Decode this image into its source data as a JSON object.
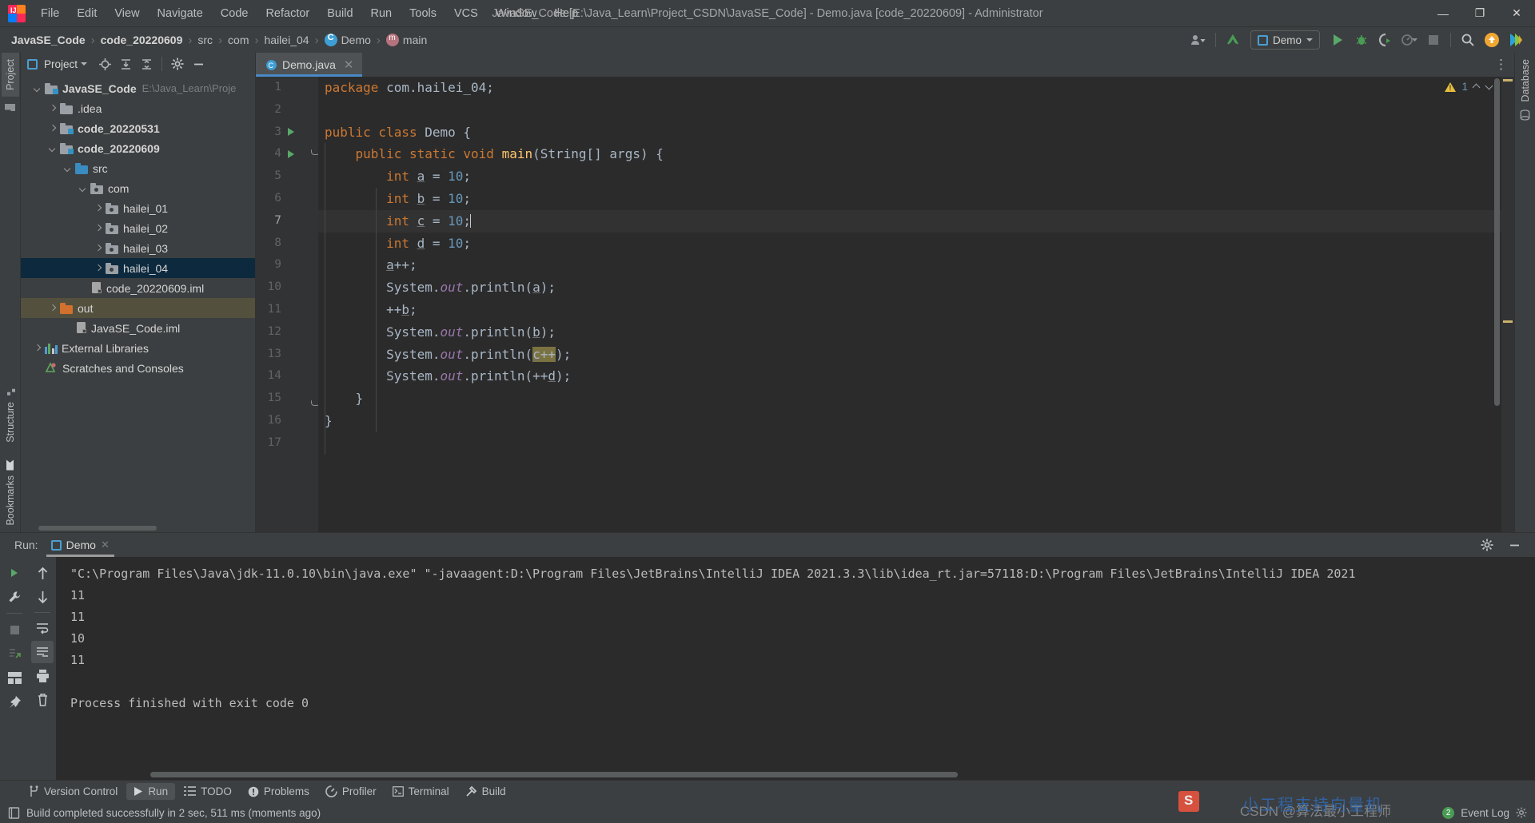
{
  "window": {
    "title": "JavaSE_Code [E:\\Java_Learn\\Project_CSDN\\JavaSE_Code] - Demo.java [code_20220609] - Administrator",
    "minimize": "—",
    "maximize": "❐",
    "close": "✕"
  },
  "menubar": {
    "items": [
      {
        "label": "File"
      },
      {
        "label": "Edit"
      },
      {
        "label": "View"
      },
      {
        "label": "Navigate"
      },
      {
        "label": "Code"
      },
      {
        "label": "Refactor"
      },
      {
        "label": "Build"
      },
      {
        "label": "Run"
      },
      {
        "label": "Tools"
      },
      {
        "label": "VCS"
      },
      {
        "label": "Window"
      },
      {
        "label": "Help"
      }
    ]
  },
  "breadcrumb": {
    "separator": "›",
    "items": [
      {
        "label": "JavaSE_Code",
        "bold": true
      },
      {
        "label": "code_20220609",
        "bold": true
      },
      {
        "label": "src",
        "bold": false
      },
      {
        "label": "com",
        "bold": false
      },
      {
        "label": "hailei_04",
        "bold": false
      },
      {
        "label": "Demo",
        "bold": false,
        "icon": "class-icon"
      },
      {
        "label": "main",
        "bold": false,
        "icon": "method-icon"
      }
    ]
  },
  "toolbar": {
    "run_config_label": "Demo",
    "icons": [
      "user-avatar-icon",
      "vcs-update-icon",
      "run-icon",
      "debug-icon",
      "run-coverage-icon",
      "profiler-icon",
      "stop-icon",
      "search-icon",
      "updates-icon",
      "ide-icon"
    ]
  },
  "left_tool_strip": {
    "top_tabs": [
      {
        "label": "Project",
        "active": true
      }
    ],
    "bottom_tabs": [
      {
        "label": "Structure"
      },
      {
        "label": "Bookmarks"
      }
    ]
  },
  "right_tool_strip": {
    "tabs": [
      {
        "label": "Database"
      }
    ]
  },
  "project_panel": {
    "title": "Project",
    "header_icons": [
      "project-view-icon",
      "chevron-down-icon",
      "locate-icon",
      "expand-all-icon",
      "collapse-all-icon",
      "settings-gear-icon",
      "hide-icon"
    ],
    "tree": [
      {
        "label": "JavaSE_Code",
        "suffix": "E:\\Java_Learn\\Proje",
        "depth": 0,
        "expander": "down",
        "icon": "module-folder-icon",
        "bold": true,
        "selected": false
      },
      {
        "label": ".idea",
        "suffix": "",
        "depth": 1,
        "expander": "right",
        "icon": "folder-gray-icon",
        "bold": false,
        "selected": false
      },
      {
        "label": "code_20220531",
        "suffix": "",
        "depth": 1,
        "expander": "right",
        "icon": "module-folder-icon",
        "bold": true,
        "selected": false
      },
      {
        "label": "code_20220609",
        "suffix": "",
        "depth": 1,
        "expander": "down",
        "icon": "module-folder-icon",
        "bold": true,
        "selected": false
      },
      {
        "label": "src",
        "suffix": "",
        "depth": 2,
        "expander": "down",
        "icon": "source-folder-icon",
        "bold": false,
        "selected": false
      },
      {
        "label": "com",
        "suffix": "",
        "depth": 3,
        "expander": "down",
        "icon": "package-icon",
        "bold": false,
        "selected": false
      },
      {
        "label": "hailei_01",
        "suffix": "",
        "depth": 4,
        "expander": "right",
        "icon": "package-icon",
        "bold": false,
        "selected": false
      },
      {
        "label": "hailei_02",
        "suffix": "",
        "depth": 4,
        "expander": "right",
        "icon": "package-icon",
        "bold": false,
        "selected": false
      },
      {
        "label": "hailei_03",
        "suffix": "",
        "depth": 4,
        "expander": "right",
        "icon": "package-icon",
        "bold": false,
        "selected": false
      },
      {
        "label": "hailei_04",
        "suffix": "",
        "depth": 4,
        "expander": "right",
        "icon": "package-icon",
        "bold": false,
        "selected": true
      },
      {
        "label": "code_20220609.iml",
        "suffix": "",
        "depth": 3,
        "expander": "none",
        "icon": "iml-file-icon",
        "bold": false,
        "selected": false
      },
      {
        "label": "out",
        "suffix": "",
        "depth": 1,
        "expander": "right",
        "icon": "excluded-folder-icon",
        "bold": false,
        "selected": false,
        "highlight": true
      },
      {
        "label": "JavaSE_Code.iml",
        "suffix": "",
        "depth": 2,
        "expander": "none",
        "icon": "iml-file-icon",
        "bold": false,
        "selected": false
      },
      {
        "label": "External Libraries",
        "suffix": "",
        "depth": 0,
        "expander": "right",
        "icon": "libraries-icon",
        "bold": false,
        "selected": false
      },
      {
        "label": "Scratches and Consoles",
        "suffix": "",
        "depth": 0,
        "expander": "none",
        "icon": "scratches-icon",
        "bold": false,
        "selected": false
      }
    ]
  },
  "editor": {
    "tab": {
      "label": "Demo.java",
      "icon": "java-class-icon",
      "close": "✕"
    },
    "inspection": {
      "warning_count": "1"
    },
    "lines": [
      {
        "n": "1",
        "run": false,
        "fold": false,
        "html": "<span class=\"kw\">package</span> com.hailei_04;"
      },
      {
        "n": "2",
        "run": false,
        "fold": false,
        "html": ""
      },
      {
        "n": "3",
        "run": true,
        "fold": false,
        "html": "<span class=\"kw\">public class</span> <span class=\"cls\">Demo</span> {"
      },
      {
        "n": "4",
        "run": true,
        "fold": true,
        "html": "    <span class=\"kw\">public static void</span> <span style=\"color:#ffc66d\">main</span>(String[] args) {"
      },
      {
        "n": "5",
        "run": false,
        "fold": false,
        "html": "        <span class=\"kw\">int</span> <span class=\"var\">a</span> = <span class=\"num\">10</span>;"
      },
      {
        "n": "6",
        "run": false,
        "fold": false,
        "html": "        <span class=\"kw\">int</span> <span class=\"var\">b</span> = <span class=\"num\">10</span>;"
      },
      {
        "n": "7",
        "run": false,
        "fold": false,
        "cur": true,
        "html": "        <span class=\"kw\">int</span> <span class=\"var\">c</span> = <span class=\"num\">10</span>;<span class=\"caret\"></span>"
      },
      {
        "n": "8",
        "run": false,
        "fold": false,
        "html": "        <span class=\"kw\">int</span> <span class=\"var\">d</span> = <span class=\"num\">10</span>;"
      },
      {
        "n": "9",
        "run": false,
        "fold": false,
        "html": "        <span class=\"var\">a</span>++;"
      },
      {
        "n": "10",
        "run": false,
        "fold": false,
        "html": "        System.<span class=\"fld\">out</span>.println(<span class=\"var\">a</span>);"
      },
      {
        "n": "11",
        "run": false,
        "fold": false,
        "html": "        ++<span class=\"var\">b</span>;"
      },
      {
        "n": "12",
        "run": false,
        "fold": false,
        "html": "        System.<span class=\"fld\">out</span>.println(<span class=\"var\">b</span>);"
      },
      {
        "n": "13",
        "run": false,
        "fold": false,
        "html": "        System.<span class=\"fld\">out</span>.println(<span class=\"hl2\"><span class=\"var\">c</span>++</span>);"
      },
      {
        "n": "14",
        "run": false,
        "fold": false,
        "html": "        System.<span class=\"fld\">out</span>.println(++<span class=\"var\">d</span>);"
      },
      {
        "n": "15",
        "run": false,
        "fold": true,
        "html": "    }"
      },
      {
        "n": "16",
        "run": false,
        "fold": false,
        "html": "}"
      },
      {
        "n": "17",
        "run": false,
        "fold": false,
        "html": ""
      }
    ]
  },
  "run_panel": {
    "label": "Run:",
    "tab": {
      "label": "Demo",
      "icon": "run-config-icon",
      "close": "✕"
    },
    "toolbar_left": [
      "rerun-icon",
      "settings-wrench-icon",
      "stop-icon",
      "rerun-failed-icon",
      "layout-icon",
      "pin-icon"
    ],
    "toolbar_right": [
      "scroll-up-icon",
      "scroll-down-icon",
      "soft-wrap-icon",
      "scroll-to-end-icon",
      "print-icon",
      "trash-icon"
    ],
    "header_icons": [
      "settings-gear-icon",
      "hide-icon"
    ],
    "console": [
      "\"C:\\Program Files\\Java\\jdk-11.0.10\\bin\\java.exe\" \"-javaagent:D:\\Program Files\\JetBrains\\IntelliJ IDEA 2021.3.3\\lib\\idea_rt.jar=57118:D:\\Program Files\\JetBrains\\IntelliJ IDEA 2021",
      "11",
      "11",
      "10",
      "11",
      "",
      "Process finished with exit code 0"
    ]
  },
  "status_strip": {
    "items": [
      {
        "label": "Version Control",
        "icon": "vcs-branch-icon",
        "active": false
      },
      {
        "label": "Run",
        "icon": "run-icon",
        "active": true
      },
      {
        "label": "TODO",
        "icon": "todo-list-icon",
        "active": false
      },
      {
        "label": "Problems",
        "icon": "problems-icon",
        "active": false
      },
      {
        "label": "Profiler",
        "icon": "profiler-icon",
        "active": false
      },
      {
        "label": "Terminal",
        "icon": "terminal-icon",
        "active": false
      },
      {
        "label": "Build",
        "icon": "build-hammer-icon",
        "active": false
      }
    ]
  },
  "status_bar": {
    "message": "Build completed successfully in 2 sec, 511 ms (moments ago)",
    "message_icon": "build-status-icon",
    "event_log": {
      "label": "Event Log",
      "badge": "2"
    }
  },
  "watermark": {
    "text": "CSDN @算法最小工程师",
    "overlay": "小工程支持向量机"
  },
  "colors": {
    "panel_bg": "#3c3f41",
    "editor_bg": "#2b2b2b",
    "gutter_bg": "#313335",
    "selection": "#0d293e",
    "accent": "#4a88c7",
    "keyword": "#cc7832",
    "number": "#6897bb",
    "field": "#9876aa",
    "warning": "#e8bd3c",
    "run_green": "#59a869"
  }
}
